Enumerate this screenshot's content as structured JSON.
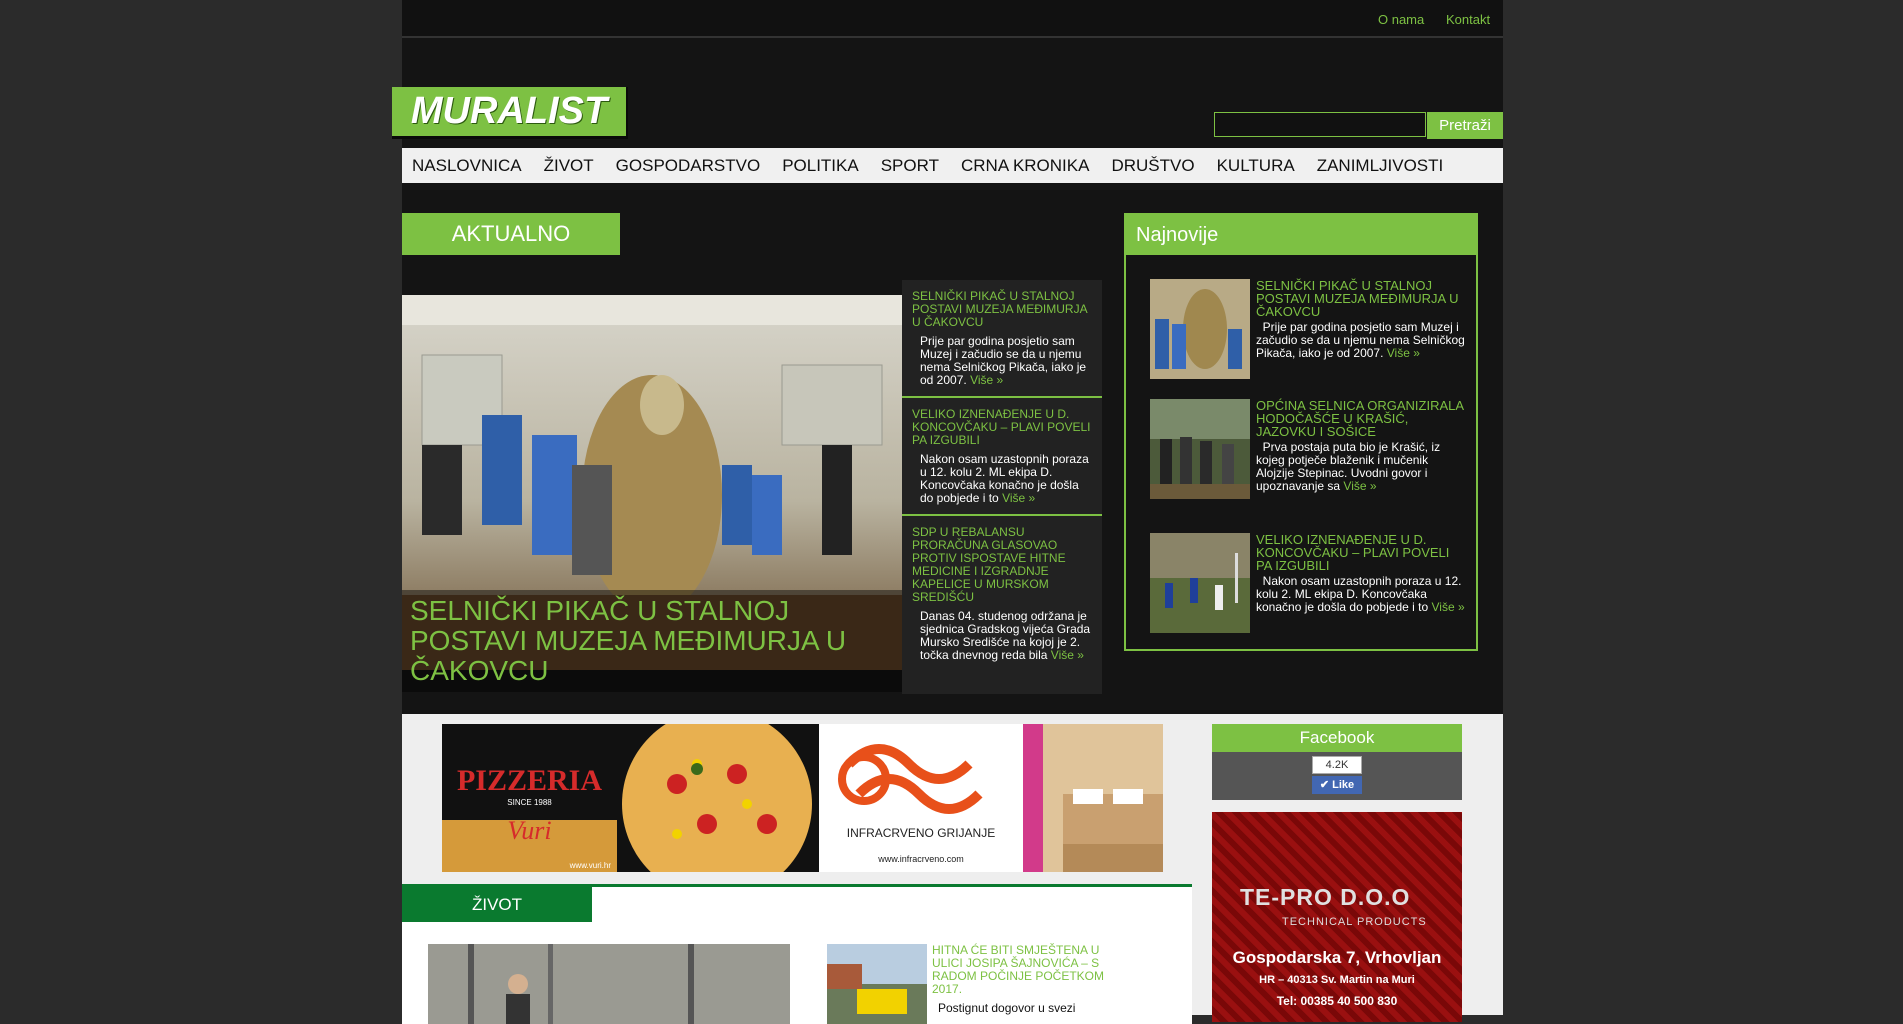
{
  "topbar": {
    "links": [
      "O nama",
      "Kontakt"
    ]
  },
  "logo": {
    "text": "MURALIST"
  },
  "search": {
    "placeholder": "",
    "button": "Pretraži"
  },
  "nav": {
    "items": [
      "NASLOVNICA",
      "ŽIVOT",
      "GOSPODARSTVO",
      "POLITIKA",
      "SPORT",
      "CRNA KRONIKA",
      "DRUŠTVO",
      "KULTURA",
      "ZANIMLJIVOSTI"
    ]
  },
  "aktualno": {
    "heading": "AKTUALNO",
    "feature_title": "SELNIČKI PIKAČ U STALNOJ POSTAVI MUZEJA MEĐIMURJA U ČAKOVCU",
    "items": [
      {
        "title": "SELNIČKI PIKAČ U STALNOJ POSTAVI MUZEJA MEĐIMURJA U ČAKOVCU",
        "text": "Prije par godina posjetio sam Muzej i začudio se da u njemu nema Selničkog Pikača, iako je od 2007.",
        "more": "Više »"
      },
      {
        "title": "VELIKO IZNENAĐENJE U D. KONCOVČAKU – PLAVI POVELI PA IZGUBILI",
        "text": "Nakon osam uzastopnih poraza u 12. kolu 2. ML ekipa D. Koncovčaka konačno je došla do pobjede i to",
        "more": "Više »"
      },
      {
        "title": "SDP U REBALANSU PRORAČUNA GLASOVAO PROTIV ISPOSTAVE HITNE MEDICINE I IZGRADNJE KAPELICE U MURSKOM SREDIŠĆU",
        "text": "Danas 04. studenog održana je sjednica Gradskog vijeća Grada Mursko Središće na kojoj je 2. točka dnevnog reda bila",
        "more": "Više »"
      }
    ]
  },
  "najnovije": {
    "heading": "Najnovije",
    "items": [
      {
        "title": "SELNIČKI PIKAČ U STALNOJ POSTAVI MUZEJA MEĐIMURJA U ČAKOVCU",
        "text": "Prije par godina posjetio sam Muzej i začudio se da u njemu nema Selničkog Pikača, iako je od 2007.",
        "more": "Više »"
      },
      {
        "title": "OPĆINA SELNICA ORGANIZIRALA HODOČAŠĆE U KRAŠIĆ, JAZOVKU I SOŠICE",
        "text": "Prva postaja puta bio je Krašić, iz kojeg potječe blaženik i mučenik Alojzije Stepinac. Uvodni govor i upoznavanje sa",
        "more": "Više »"
      },
      {
        "title": "VELIKO IZNENAĐENJE U D. KONCOVČAKU – PLAVI POVELI PA IZGUBILI",
        "text": "Nakon osam uzastopnih poraza u 12. kolu 2. ML ekipa D. Koncovčaka konačno je došla do pobjede i to",
        "more": "Više »"
      }
    ]
  },
  "ads": {
    "pizzeria_name": "PIZZERIA",
    "pizzeria_since": "SINCE 1988",
    "pizzeria_brand": "Vuri",
    "pizzeria_url": "www.vuri.hr",
    "infra_text": "INFRACRVENO GRIJANJE",
    "infra_url": "www.infracrveno.com"
  },
  "facebook": {
    "heading": "Facebook",
    "count": "4.2K",
    "like": "Like"
  },
  "tepro": {
    "name": "TE-PRO D.O.O",
    "sub": "TECHNICAL PRODUCTS",
    "address": "Gospodarska 7, Vrhovljan",
    "city": "HR – 40313 Sv. Martin na Muri",
    "phone": "Tel: 00385 40 500 830"
  },
  "zivot": {
    "heading": "ŽIVOT",
    "item_title": "HITNA ĆE BITI SMJEŠTENA U ULICI JOSIPA ŠAJNOVIĆA – S RADOM POČINJE POČETKOM 2017.",
    "item_text": "Postignut dogovor u svezi"
  },
  "colors": {
    "accent": "#7dc143",
    "dark": "#141414",
    "zivot_green": "#0a7a2f"
  }
}
